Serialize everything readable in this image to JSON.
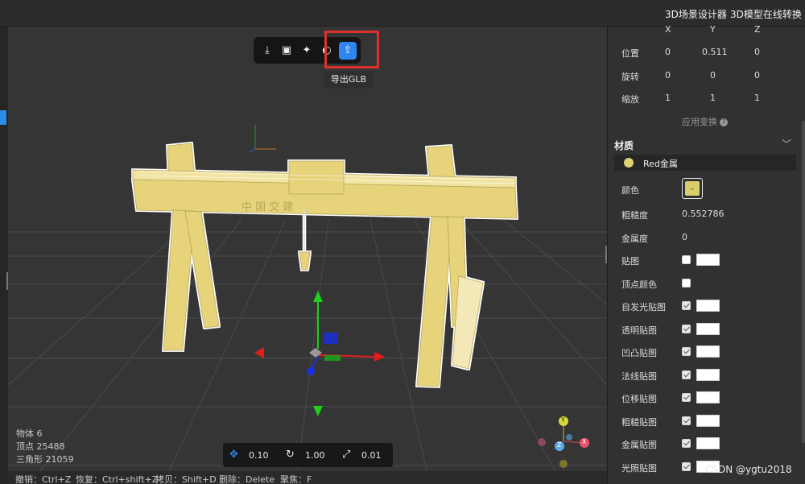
{
  "topbar": {
    "link1": "3D场景设计器",
    "link2": "3D模型在线转换"
  },
  "toolbar": {
    "buttons": [
      "import-icon",
      "screenshot-icon",
      "light-icon",
      "rotate-icon",
      "export-icon"
    ],
    "tooltip": "导出GLB"
  },
  "stats": {
    "objects": "物体 6",
    "vertices": "顶点 25488",
    "triangles": "三角形 21059"
  },
  "transform_bar": {
    "move_value": "0.10",
    "rotate_value": "1.00",
    "scale_value": "0.01"
  },
  "shortcuts": {
    "undo": "撤销：Ctrl+Z",
    "redo": "恢复：Ctrl+shift+Z",
    "copy": "拷贝：Shift+D",
    "delete": "删除：Delete",
    "focus": "聚焦：F"
  },
  "panel": {
    "axes": [
      "X",
      "Y",
      "Z"
    ],
    "position": {
      "label": "位置",
      "x": "0",
      "y": "0.511",
      "z": "0"
    },
    "rotation": {
      "label": "旋转",
      "x": "0",
      "y": "0",
      "z": "0"
    },
    "scale": {
      "label": "缩放",
      "x": "1",
      "y": "1",
      "z": "1"
    },
    "apply_label": "应用变换",
    "material_title": "材质",
    "material_name": "Red金属",
    "props": {
      "color": "颜色",
      "roughness": "粗糙度",
      "roughness_value": "0.552786",
      "metalness": "金属度",
      "metalness_value": "0",
      "map": "贴图",
      "vertex_colors": "顶点颜色",
      "emissive_map": "自发光贴图",
      "alpha_map": "透明贴图",
      "bump_map": "凹凸贴图",
      "normal_map": "法线贴图",
      "displacement_map": "位移贴图",
      "roughness_map": "粗糙贴图",
      "metalness_map": "金属贴图",
      "light_map": "光照贴图"
    }
  },
  "gizmo": {
    "x": "X",
    "y": "Y",
    "z": "Z"
  },
  "watermark": "CSDN @ygtu2018",
  "colors": {
    "accent": "#2e86f0",
    "highlight": "#e0302e",
    "crane": "#e6d37a",
    "material": "#dcd474"
  }
}
